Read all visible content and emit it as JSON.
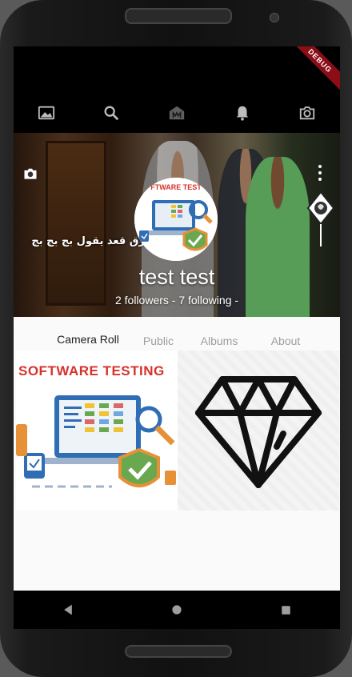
{
  "debug_banner": "DEBUG",
  "toolbar": {
    "icons": [
      "image-icon",
      "search-icon",
      "home-icon",
      "bell-icon",
      "camera-icon"
    ]
  },
  "profile": {
    "cover_caption": "بيغرق قعد يقول بج بج بج",
    "avatar_banner": "SOFTWARE TESTING",
    "name": "test test",
    "stats": "2 followers - 7 following -"
  },
  "tabs": [
    {
      "label": "Camera Roll",
      "active": true
    },
    {
      "label": "Public",
      "active": false
    },
    {
      "label": "Albums",
      "active": false
    },
    {
      "label": "About",
      "active": false
    }
  ],
  "photos": [
    {
      "title": "SOFTWARE TESTING",
      "kind": "software-testing-illustration"
    },
    {
      "title": "",
      "kind": "diamond-icon"
    }
  ],
  "colors": {
    "accent_red": "#d6322c",
    "debug_red": "#8b0d16",
    "tab_active": "#212121",
    "tab_inactive": "#9e9e9e"
  }
}
